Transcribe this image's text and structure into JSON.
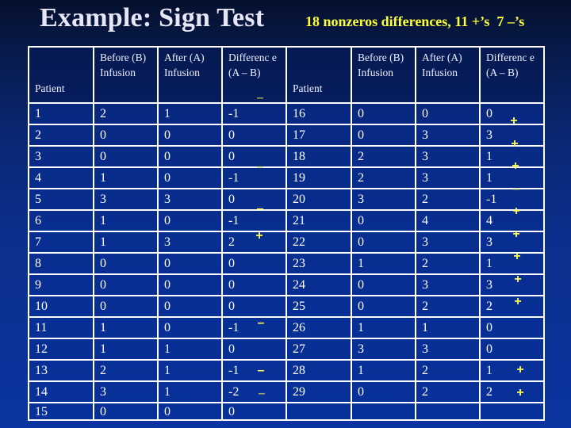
{
  "slide": {
    "title": "Example: Sign Test",
    "subtitle": "18 nonzeros differences, 11 +’s  7 –’s",
    "colors": {
      "title": "#e6e6f6",
      "subtitle": "#ffff33",
      "sign_marks": "#ffff55",
      "table_border": "#ffffff",
      "background": "#0b2f8c"
    }
  },
  "table": {
    "headers": [
      "Patient",
      "Before (B) Infusion",
      "After (A) Infusion",
      "Differenc e (A – B)",
      "Patient",
      "Before (B) Infusion",
      "After (A) Infusion",
      "Differenc e (A – B)"
    ],
    "rows": [
      [
        "1",
        "2",
        "1",
        "-1",
        "16",
        "0",
        "0",
        "0"
      ],
      [
        "2",
        "0",
        "0",
        "0",
        "17",
        "0",
        "3",
        "3"
      ],
      [
        "3",
        "0",
        "0",
        "0",
        "18",
        "2",
        "3",
        "1"
      ],
      [
        "4",
        "1",
        "0",
        "-1",
        "19",
        "2",
        "3",
        "1"
      ],
      [
        "5",
        "3",
        "3",
        "0",
        "20",
        "3",
        "2",
        "-1"
      ],
      [
        "6",
        "1",
        "0",
        "-1",
        "21",
        "0",
        "4",
        "4"
      ],
      [
        "7",
        "1",
        "3",
        "2",
        "22",
        "0",
        "3",
        "3"
      ],
      [
        "8",
        "0",
        "0",
        "0",
        "23",
        "1",
        "2",
        "1"
      ],
      [
        "9",
        "0",
        "0",
        "0",
        "24",
        "0",
        "3",
        "3"
      ],
      [
        "10",
        "0",
        "0",
        "0",
        "25",
        "0",
        "2",
        "2"
      ],
      [
        "11",
        "1",
        "0",
        "-1",
        "26",
        "1",
        "1",
        "0"
      ],
      [
        "12",
        "1",
        "1",
        "0",
        "27",
        "3",
        "3",
        "0"
      ],
      [
        "13",
        "2",
        "1",
        "-1",
        "28",
        "1",
        "2",
        "1"
      ],
      [
        "14",
        "3",
        "1",
        "-2",
        "29",
        "0",
        "2",
        "2"
      ],
      [
        "15",
        "0",
        "0",
        "0",
        "",
        "",
        "",
        ""
      ]
    ]
  },
  "sign_marks": {
    "left": [
      "–",
      "–",
      "–",
      "+",
      "–",
      "–",
      "–"
    ],
    "right": [
      "+",
      "+",
      "+",
      "–",
      "+",
      "+",
      "+",
      "+",
      "+",
      "+",
      "+"
    ]
  }
}
